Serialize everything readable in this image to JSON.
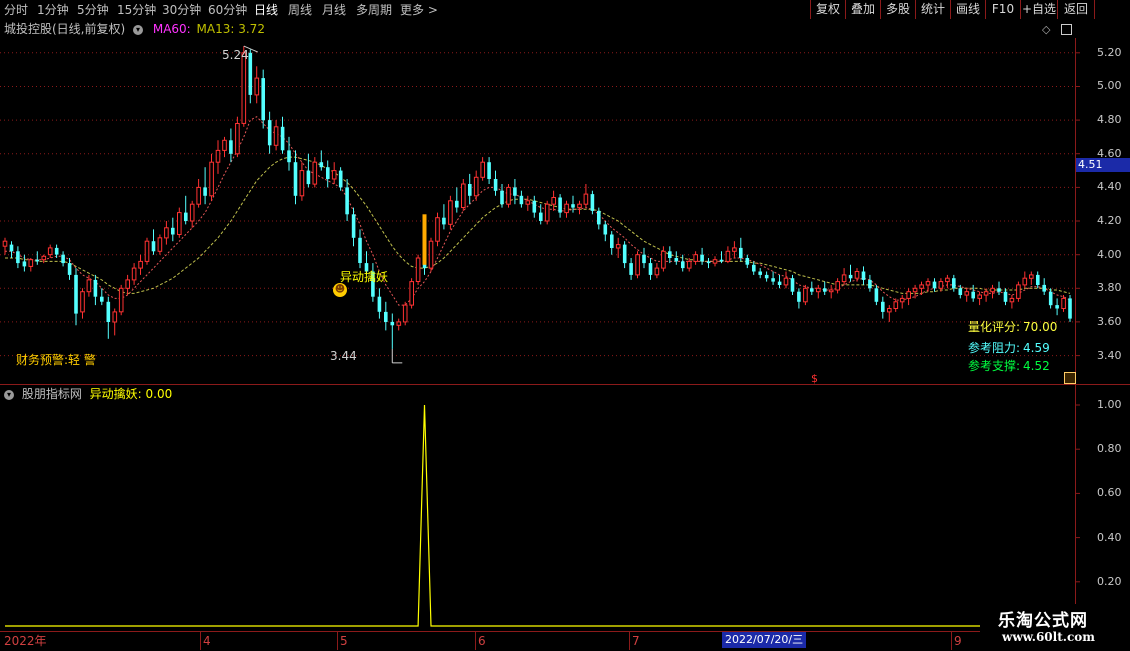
{
  "toolbar": {
    "periods": [
      "分时",
      "1分钟",
      "5分钟",
      "15分钟",
      "30分钟",
      "60分钟",
      "日线",
      "周线",
      "月线",
      "多周期",
      "更多 >"
    ],
    "active_period": "日线",
    "buttons": [
      "复权",
      "叠加",
      "多股",
      "统计",
      "画线",
      "F10",
      "+自选",
      "返回"
    ]
  },
  "main": {
    "stock_title": "城投控股(日线,前复权)",
    "ma60_label": "MA60:",
    "ma13_label": "MA13: 3.72",
    "high_label": "5.24",
    "low_label": "3.44",
    "signal_text": "异动擒妖",
    "signal_icon": "smiley-icon",
    "warning_text": "财务预警:轻 警",
    "quant_score_label": "量化评分:",
    "quant_score_value": "70.00",
    "resistance_label": "参考阻力:",
    "resistance_value": "4.59",
    "support_label": "参考支撑:",
    "support_value": "4.52",
    "current_price": "4.51",
    "dollar_marker": "$",
    "y_axis": [
      "5.20",
      "5.00",
      "4.80",
      "4.60",
      "4.40",
      "4.20",
      "4.00",
      "3.80",
      "3.60",
      "3.40"
    ]
  },
  "indicator": {
    "title": "股朋指标网",
    "value_label": "异动擒妖: 0.00",
    "y_axis": [
      "1.00",
      "0.80",
      "0.60",
      "0.40",
      "0.20"
    ]
  },
  "x_axis": {
    "labels": [
      "2022年",
      "4",
      "5",
      "6",
      "7",
      "9"
    ],
    "cursor_date": "2022/07/20/三"
  },
  "watermark": {
    "title": "乐淘公式网",
    "url": "www.60lt.com"
  },
  "colors": {
    "up": "#ff3232",
    "down": "#54ffff",
    "ma_short": "#ff6060",
    "ma_long": "#ffff66",
    "signal": "#ffff00",
    "grid": "#8b1a1a",
    "ma60": "#ff33ff",
    "ma13": "#dddd22"
  },
  "chart_data": {
    "type": "candlestick",
    "ylim": [
      3.35,
      5.3
    ],
    "indicator_ylim": [
      0,
      1.0
    ],
    "high": 5.24,
    "low": 3.44,
    "signal_index": 65,
    "signal_value": 1.0,
    "candles": [
      [
        4.05,
        4.1,
        4.0,
        4.08
      ],
      [
        4.06,
        4.08,
        3.98,
        4.02
      ],
      [
        4.02,
        4.05,
        3.92,
        3.95
      ],
      [
        3.96,
        4.0,
        3.9,
        3.93
      ],
      [
        3.93,
        3.98,
        3.9,
        3.97
      ],
      [
        3.97,
        4.02,
        3.94,
        3.96
      ],
      [
        3.97,
        4.0,
        3.95,
        3.99
      ],
      [
        4.0,
        4.06,
        3.98,
        4.04
      ],
      [
        4.04,
        4.06,
        3.98,
        4.0
      ],
      [
        4.0,
        4.02,
        3.93,
        3.95
      ],
      [
        3.95,
        3.98,
        3.85,
        3.88
      ],
      [
        3.88,
        3.92,
        3.58,
        3.65
      ],
      [
        3.66,
        3.8,
        3.62,
        3.78
      ],
      [
        3.78,
        3.88,
        3.75,
        3.85
      ],
      [
        3.85,
        3.88,
        3.7,
        3.75
      ],
      [
        3.75,
        3.8,
        3.7,
        3.72
      ],
      [
        3.72,
        3.75,
        3.5,
        3.6
      ],
      [
        3.6,
        3.68,
        3.52,
        3.66
      ],
      [
        3.66,
        3.82,
        3.64,
        3.8
      ],
      [
        3.8,
        3.88,
        3.76,
        3.85
      ],
      [
        3.85,
        3.95,
        3.82,
        3.92
      ],
      [
        3.92,
        4.0,
        3.88,
        3.96
      ],
      [
        3.96,
        4.1,
        3.94,
        4.08
      ],
      [
        4.08,
        4.15,
        4.0,
        4.02
      ],
      [
        4.02,
        4.12,
        4.0,
        4.1
      ],
      [
        4.1,
        4.2,
        4.06,
        4.16
      ],
      [
        4.16,
        4.22,
        4.08,
        4.12
      ],
      [
        4.12,
        4.28,
        4.1,
        4.25
      ],
      [
        4.25,
        4.35,
        4.18,
        4.2
      ],
      [
        4.2,
        4.32,
        4.16,
        4.3
      ],
      [
        4.3,
        4.45,
        4.28,
        4.4
      ],
      [
        4.4,
        4.52,
        4.3,
        4.35
      ],
      [
        4.35,
        4.6,
        4.32,
        4.55
      ],
      [
        4.55,
        4.68,
        4.48,
        4.62
      ],
      [
        4.62,
        4.7,
        4.58,
        4.68
      ],
      [
        4.68,
        4.75,
        4.55,
        4.6
      ],
      [
        4.6,
        4.82,
        4.58,
        4.78
      ],
      [
        4.78,
        5.24,
        4.76,
        5.2
      ],
      [
        5.2,
        5.22,
        4.9,
        4.95
      ],
      [
        4.95,
        5.12,
        4.9,
        5.05
      ],
      [
        5.05,
        5.1,
        4.75,
        4.8
      ],
      [
        4.8,
        4.85,
        4.6,
        4.65
      ],
      [
        4.65,
        4.8,
        4.62,
        4.76
      ],
      [
        4.76,
        4.82,
        4.6,
        4.62
      ],
      [
        4.62,
        4.7,
        4.5,
        4.55
      ],
      [
        4.55,
        4.62,
        4.3,
        4.35
      ],
      [
        4.35,
        4.55,
        4.32,
        4.5
      ],
      [
        4.5,
        4.6,
        4.4,
        4.42
      ],
      [
        4.42,
        4.58,
        4.4,
        4.55
      ],
      [
        4.55,
        4.62,
        4.5,
        4.52
      ],
      [
        4.52,
        4.56,
        4.4,
        4.45
      ],
      [
        4.45,
        4.55,
        4.42,
        4.5
      ],
      [
        4.5,
        4.52,
        4.38,
        4.4
      ],
      [
        4.4,
        4.45,
        4.2,
        4.24
      ],
      [
        4.24,
        4.28,
        4.05,
        4.1
      ],
      [
        4.1,
        4.15,
        3.92,
        3.95
      ],
      [
        3.95,
        4.02,
        3.88,
        3.9
      ],
      [
        3.9,
        3.95,
        3.72,
        3.75
      ],
      [
        3.75,
        3.8,
        3.62,
        3.66
      ],
      [
        3.66,
        3.72,
        3.55,
        3.6
      ],
      [
        3.6,
        3.65,
        3.44,
        3.58
      ],
      [
        3.58,
        3.62,
        3.55,
        3.6
      ],
      [
        3.6,
        3.72,
        3.58,
        3.7
      ],
      [
        3.7,
        3.86,
        3.68,
        3.84
      ],
      [
        3.84,
        4.0,
        3.82,
        3.98
      ],
      [
        3.98,
        4.05,
        3.88,
        3.92
      ],
      [
        3.92,
        4.1,
        3.9,
        4.08
      ],
      [
        4.08,
        4.25,
        4.05,
        4.22
      ],
      [
        4.22,
        4.3,
        4.15,
        4.18
      ],
      [
        4.18,
        4.35,
        4.15,
        4.32
      ],
      [
        4.32,
        4.4,
        4.25,
        4.28
      ],
      [
        4.28,
        4.45,
        4.26,
        4.42
      ],
      [
        4.42,
        4.48,
        4.3,
        4.35
      ],
      [
        4.35,
        4.5,
        4.32,
        4.46
      ],
      [
        4.46,
        4.58,
        4.44,
        4.55
      ],
      [
        4.55,
        4.58,
        4.42,
        4.45
      ],
      [
        4.45,
        4.5,
        4.35,
        4.38
      ],
      [
        4.38,
        4.42,
        4.28,
        4.3
      ],
      [
        4.3,
        4.42,
        4.28,
        4.4
      ],
      [
        4.4,
        4.45,
        4.3,
        4.35
      ],
      [
        4.35,
        4.38,
        4.28,
        4.3
      ],
      [
        4.3,
        4.35,
        4.26,
        4.32
      ],
      [
        4.32,
        4.35,
        4.22,
        4.25
      ],
      [
        4.25,
        4.3,
        4.18,
        4.2
      ],
      [
        4.2,
        4.32,
        4.18,
        4.3
      ],
      [
        4.3,
        4.38,
        4.26,
        4.34
      ],
      [
        4.34,
        4.36,
        4.22,
        4.25
      ],
      [
        4.25,
        4.32,
        4.22,
        4.3
      ],
      [
        4.3,
        4.35,
        4.25,
        4.28
      ],
      [
        4.28,
        4.32,
        4.24,
        4.3
      ],
      [
        4.3,
        4.42,
        4.28,
        4.36
      ],
      [
        4.36,
        4.38,
        4.24,
        4.26
      ],
      [
        4.26,
        4.28,
        4.15,
        4.18
      ],
      [
        4.18,
        4.2,
        4.08,
        4.12
      ],
      [
        4.12,
        4.14,
        4.0,
        4.04
      ],
      [
        4.04,
        4.1,
        3.98,
        4.06
      ],
      [
        4.06,
        4.08,
        3.92,
        3.95
      ],
      [
        3.95,
        3.98,
        3.85,
        3.88
      ],
      [
        3.88,
        4.02,
        3.86,
        4.0
      ],
      [
        4.0,
        4.04,
        3.92,
        3.95
      ],
      [
        3.95,
        3.98,
        3.85,
        3.88
      ],
      [
        3.88,
        3.95,
        3.86,
        3.92
      ],
      [
        3.92,
        4.05,
        3.9,
        4.02
      ],
      [
        4.02,
        4.05,
        3.95,
        3.98
      ],
      [
        3.98,
        4.02,
        3.94,
        3.96
      ],
      [
        3.96,
        4.0,
        3.9,
        3.92
      ],
      [
        3.92,
        3.98,
        3.9,
        3.96
      ],
      [
        3.96,
        4.02,
        3.94,
        4.0
      ],
      [
        4.0,
        4.04,
        3.94,
        3.96
      ],
      [
        3.96,
        3.98,
        3.92,
        3.95
      ],
      [
        3.95,
        3.99,
        3.93,
        3.97
      ],
      [
        3.97,
        4.02,
        3.95,
        3.96
      ],
      [
        3.96,
        4.05,
        3.95,
        4.02
      ],
      [
        4.02,
        4.08,
        3.98,
        4.04
      ],
      [
        4.04,
        4.1,
        3.96,
        3.98
      ],
      [
        3.98,
        4.0,
        3.92,
        3.94
      ],
      [
        3.94,
        3.96,
        3.88,
        3.9
      ],
      [
        3.9,
        3.92,
        3.86,
        3.88
      ],
      [
        3.88,
        3.9,
        3.84,
        3.86
      ],
      [
        3.86,
        3.9,
        3.82,
        3.84
      ],
      [
        3.84,
        3.88,
        3.8,
        3.82
      ],
      [
        3.82,
        3.9,
        3.8,
        3.86
      ],
      [
        3.86,
        3.88,
        3.76,
        3.78
      ],
      [
        3.78,
        3.8,
        3.68,
        3.72
      ],
      [
        3.72,
        3.82,
        3.7,
        3.8
      ],
      [
        3.8,
        3.84,
        3.76,
        3.78
      ],
      [
        3.78,
        3.82,
        3.74,
        3.8
      ],
      [
        3.8,
        3.84,
        3.76,
        3.78
      ],
      [
        3.78,
        3.82,
        3.74,
        3.79
      ],
      [
        3.79,
        3.86,
        3.77,
        3.84
      ],
      [
        3.84,
        3.92,
        3.82,
        3.88
      ],
      [
        3.88,
        3.94,
        3.84,
        3.86
      ],
      [
        3.86,
        3.92,
        3.84,
        3.9
      ],
      [
        3.9,
        3.93,
        3.82,
        3.85
      ],
      [
        3.85,
        3.88,
        3.78,
        3.8
      ],
      [
        3.8,
        3.82,
        3.7,
        3.72
      ],
      [
        3.72,
        3.75,
        3.62,
        3.66
      ],
      [
        3.66,
        3.7,
        3.6,
        3.68
      ],
      [
        3.68,
        3.74,
        3.66,
        3.72
      ],
      [
        3.72,
        3.76,
        3.68,
        3.74
      ],
      [
        3.74,
        3.8,
        3.7,
        3.78
      ],
      [
        3.78,
        3.82,
        3.74,
        3.8
      ],
      [
        3.8,
        3.84,
        3.76,
        3.82
      ],
      [
        3.82,
        3.86,
        3.78,
        3.84
      ],
      [
        3.84,
        3.86,
        3.78,
        3.8
      ],
      [
        3.8,
        3.86,
        3.78,
        3.84
      ],
      [
        3.84,
        3.88,
        3.8,
        3.86
      ],
      [
        3.86,
        3.88,
        3.78,
        3.8
      ],
      [
        3.8,
        3.82,
        3.74,
        3.76
      ],
      [
        3.76,
        3.8,
        3.72,
        3.78
      ],
      [
        3.78,
        3.82,
        3.72,
        3.74
      ],
      [
        3.74,
        3.78,
        3.7,
        3.76
      ],
      [
        3.76,
        3.8,
        3.72,
        3.78
      ],
      [
        3.78,
        3.82,
        3.74,
        3.8
      ],
      [
        3.8,
        3.84,
        3.76,
        3.78
      ],
      [
        3.78,
        3.8,
        3.7,
        3.72
      ],
      [
        3.72,
        3.76,
        3.68,
        3.74
      ],
      [
        3.74,
        3.84,
        3.72,
        3.82
      ],
      [
        3.82,
        3.9,
        3.8,
        3.86
      ],
      [
        3.86,
        3.9,
        3.82,
        3.88
      ],
      [
        3.88,
        3.9,
        3.8,
        3.82
      ],
      [
        3.82,
        3.86,
        3.76,
        3.78
      ],
      [
        3.78,
        3.8,
        3.68,
        3.7
      ],
      [
        3.7,
        3.74,
        3.64,
        3.68
      ],
      [
        3.68,
        3.76,
        3.66,
        3.74
      ],
      [
        3.74,
        3.76,
        3.6,
        3.62
      ]
    ],
    "ma_short": [
      4.02,
      4.02,
      4.0,
      3.98,
      3.97,
      3.97,
      3.97,
      3.98,
      3.99,
      3.99,
      3.97,
      3.92,
      3.88,
      3.86,
      3.84,
      3.8,
      3.76,
      3.74,
      3.74,
      3.76,
      3.8,
      3.84,
      3.88,
      3.92,
      3.96,
      4.0,
      4.04,
      4.08,
      4.12,
      4.16,
      4.2,
      4.25,
      4.32,
      4.4,
      4.48,
      4.55,
      4.62,
      4.7,
      4.8,
      4.82,
      4.78,
      4.74,
      4.72,
      4.7,
      4.66,
      4.6,
      4.55,
      4.5,
      4.48,
      4.46,
      4.44,
      4.42,
      4.4,
      4.34,
      4.26,
      4.18,
      4.08,
      4.0,
      3.9,
      3.82,
      3.76,
      3.7,
      3.7,
      3.74,
      3.8,
      3.84,
      3.9,
      3.98,
      4.06,
      4.14,
      4.2,
      4.26,
      4.3,
      4.34,
      4.38,
      4.4,
      4.4,
      4.38,
      4.36,
      4.36,
      4.34,
      4.32,
      4.3,
      4.28,
      4.27,
      4.27,
      4.26,
      4.26,
      4.27,
      4.27,
      4.28,
      4.27,
      4.24,
      4.2,
      4.16,
      4.13,
      4.1,
      4.06,
      4.03,
      4.0,
      3.98,
      3.96,
      3.96,
      3.96,
      3.96,
      3.96,
      3.96,
      3.96,
      3.96,
      3.96,
      3.96,
      3.96,
      3.97,
      3.98,
      3.98,
      3.97,
      3.96,
      3.94,
      3.92,
      3.9,
      3.88,
      3.87,
      3.85,
      3.82,
      3.81,
      3.8,
      3.8,
      3.79,
      3.79,
      3.8,
      3.82,
      3.84,
      3.85,
      3.86,
      3.85,
      3.82,
      3.78,
      3.75,
      3.73,
      3.73,
      3.74,
      3.75,
      3.77,
      3.79,
      3.8,
      3.81,
      3.82,
      3.82,
      3.81,
      3.8,
      3.79,
      3.78,
      3.77,
      3.77,
      3.78,
      3.77,
      3.76,
      3.77,
      3.79,
      3.81,
      3.81,
      3.8,
      3.78,
      3.76,
      3.75,
      3.73
    ],
    "ma_long": [
      3.98,
      3.98,
      3.98,
      3.97,
      3.97,
      3.96,
      3.96,
      3.96,
      3.96,
      3.96,
      3.95,
      3.93,
      3.91,
      3.89,
      3.87,
      3.85,
      3.82,
      3.8,
      3.78,
      3.77,
      3.77,
      3.78,
      3.79,
      3.8,
      3.82,
      3.84,
      3.86,
      3.89,
      3.92,
      3.95,
      3.98,
      4.02,
      4.06,
      4.1,
      4.15,
      4.2,
      4.26,
      4.32,
      4.38,
      4.44,
      4.48,
      4.52,
      4.55,
      4.57,
      4.58,
      4.58,
      4.57,
      4.56,
      4.55,
      4.53,
      4.51,
      4.49,
      4.46,
      4.43,
      4.39,
      4.34,
      4.29,
      4.23,
      4.17,
      4.11,
      4.05,
      4.0,
      3.96,
      3.93,
      3.92,
      3.92,
      3.93,
      3.95,
      3.98,
      4.02,
      4.06,
      4.1,
      4.14,
      4.18,
      4.22,
      4.25,
      4.28,
      4.3,
      4.32,
      4.33,
      4.33,
      4.33,
      4.32,
      4.31,
      4.3,
      4.29,
      4.28,
      4.27,
      4.27,
      4.27,
      4.27,
      4.27,
      4.26,
      4.24,
      4.22,
      4.2,
      4.17,
      4.14,
      4.11,
      4.08,
      4.06,
      4.04,
      4.02,
      4.0,
      3.99,
      3.98,
      3.97,
      3.97,
      3.96,
      3.96,
      3.96,
      3.96,
      3.96,
      3.96,
      3.96,
      3.96,
      3.95,
      3.95,
      3.94,
      3.93,
      3.92,
      3.91,
      3.9,
      3.88,
      3.87,
      3.86,
      3.85,
      3.84,
      3.83,
      3.82,
      3.82,
      3.82,
      3.82,
      3.82,
      3.82,
      3.81,
      3.8,
      3.79,
      3.78,
      3.77,
      3.77,
      3.77,
      3.77,
      3.78,
      3.78,
      3.79,
      3.79,
      3.8,
      3.8,
      3.8,
      3.8,
      3.8,
      3.79,
      3.79,
      3.79,
      3.79,
      3.79,
      3.79,
      3.8,
      3.8,
      3.8,
      3.8,
      3.79,
      3.79,
      3.78,
      3.77
    ]
  }
}
